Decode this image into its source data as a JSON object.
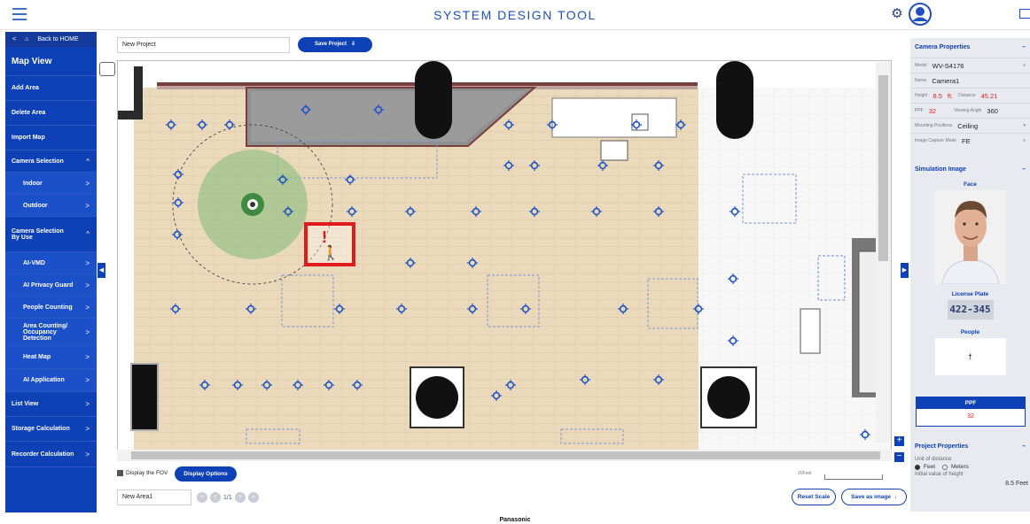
{
  "header": {
    "title": "SYSTEM DESIGN TOOL"
  },
  "sidebar": {
    "back_label": "Back to HOME",
    "items": [
      {
        "label": "Map View",
        "big": true,
        "chevron": ""
      },
      {
        "label": "Add Area",
        "chevron": ""
      },
      {
        "label": "Delete Area",
        "chevron": ""
      },
      {
        "label": "Import Map",
        "chevron": ""
      },
      {
        "label": "Camera Selection",
        "chevron": "^"
      },
      {
        "label": "Indoor",
        "sub": true,
        "chevron": ">"
      },
      {
        "label": "Outdoor",
        "sub": true,
        "chevron": ">"
      },
      {
        "label": "Camera Selection\nBy Use",
        "chevron": "^"
      },
      {
        "label": "AI-VMD",
        "sub": true,
        "chevron": ">"
      },
      {
        "label": "AI Privacy Guard",
        "sub": true,
        "chevron": ">"
      },
      {
        "label": "People Counting",
        "sub": true,
        "chevron": ">"
      },
      {
        "label": "Area Counting/\nOccupancy Detection",
        "sub": true,
        "chevron": ">"
      },
      {
        "label": "Heat Map",
        "sub": true,
        "chevron": ">"
      },
      {
        "label": "AI Application",
        "sub": true,
        "chevron": ">"
      },
      {
        "label": "List View",
        "chevron": ">"
      },
      {
        "label": "Storage Calculation",
        "chevron": ">"
      },
      {
        "label": "Recorder Calculation",
        "chevron": ">"
      }
    ]
  },
  "toolbar": {
    "project_name": "New Project",
    "save_label": "Save Project"
  },
  "bottom": {
    "fov_label": "Display the FOV",
    "display_options": "Display Options",
    "scale_label": "20Feet",
    "area_name": "New Area1",
    "page": "1/1",
    "reset_scale": "Reset Scale",
    "save_image": "Save as image"
  },
  "right_panel": {
    "camera_properties": "Camera Properties",
    "model_label": "Model",
    "model": "WV-S4176",
    "name_label": "Name",
    "name": "Camera1",
    "height_label": "Height",
    "height": "8.5",
    "unit": "ft.",
    "distance_label": "Distance",
    "distance": "45.21",
    "ppf_label": "PPF",
    "ppf": "32",
    "viewing_angle_label": "Viewing Angle",
    "viewing_angle": "360",
    "mounting_label": "Mounting Positions",
    "mounting": "Ceiling",
    "capture_label": "Image Capture Mode",
    "capture": "FE",
    "simulation_image": "Simulation Image",
    "face": "Face",
    "license_plate": "License Plate",
    "plate_text": "422-345",
    "people": "People",
    "ppf_title": "PPF",
    "ppf_value": "32",
    "project_properties": "Project Properties",
    "unit_of_distance": "Unit of distance",
    "feet": "Feet",
    "meters": "Meters",
    "initial_height_label": "Initial value of height",
    "initial_height": "8.5",
    "initial_unit": "Feet"
  },
  "footer": {
    "brand": "Panasonic"
  },
  "colors": {
    "primary": "#0e41b5",
    "floor": "#ebd9bb",
    "alert": "#e01b1b",
    "fov": "#9bc28a"
  }
}
